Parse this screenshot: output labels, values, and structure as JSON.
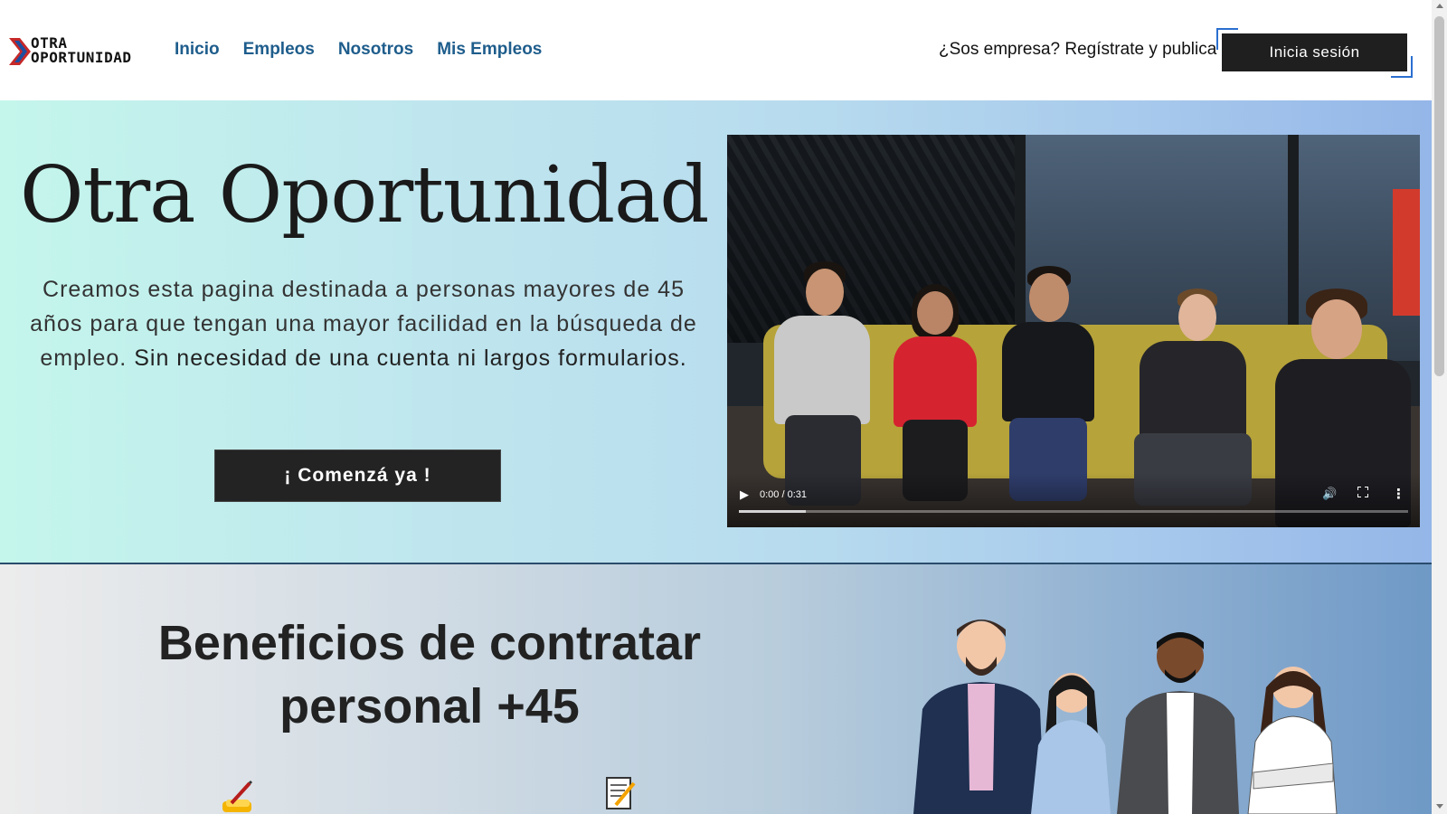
{
  "brand": {
    "line1": "OTRA",
    "line2": "OPORTUNIDAD",
    "mark_color": "#c62828"
  },
  "nav": {
    "links": [
      "Inicio",
      "Empleos",
      "Nosotros",
      "Mis Empleos"
    ],
    "company_cta": "¿Sos empresa? Regístrate y publica",
    "login_label": "Inicia sesión",
    "link_color": "#1e5d8c"
  },
  "hero": {
    "title": "Otra Oportunidad",
    "text_part1": "Creamos esta pagina destinada a personas mayores de 45 años para que tengan una mayor facilidad en la búsqueda de empleo.",
    "text_part2": "Sin necesidad de una cuenta ni largos formularios.",
    "cta_label": "¡ Comenzá ya !"
  },
  "video": {
    "time": "0:00 / 0:31",
    "buffered_fraction": 0.1,
    "play_icon": "play-icon",
    "volume_icon": "volume-icon",
    "fullscreen_icon": "fullscreen-icon",
    "more_icon": "more-options-icon"
  },
  "benefits": {
    "title_line1": "Beneficios de contratar",
    "title_line2": "personal +45",
    "icons": [
      "writing-hand-icon",
      "memo-icon"
    ]
  }
}
